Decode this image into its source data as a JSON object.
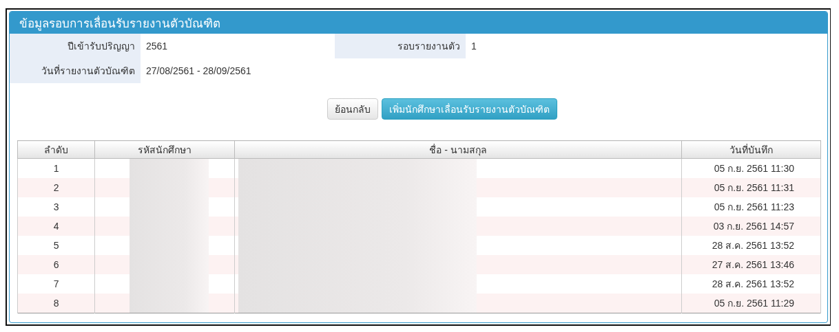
{
  "panel": {
    "title": "ข้อมูลรอบการเลื่อนรับรายงานตัวบัณฑิต"
  },
  "fields": [
    {
      "label": "ปีเข้ารับปริญญา",
      "value": "2561"
    },
    {
      "label": "รอบรายงานตัว",
      "value": "1"
    },
    {
      "label": "วันที่รายงานตัวบัณฑิต",
      "value": "27/08/2561 - 28/09/2561"
    }
  ],
  "buttons": [
    {
      "label": "ย้อนกลับ",
      "kind": "default"
    },
    {
      "label": "เพิ่มนักศึกษาเลื่อนรับรายงานตัวบัณฑิต",
      "kind": "primary"
    }
  ],
  "table": {
    "columns": [
      "ลำดับ",
      "รหัสนักศึกษา",
      "ชื่อ - นามสกุล",
      "วันที่บันทึก"
    ],
    "rows": [
      {
        "no": "1",
        "redacted": true,
        "date": "05 ก.ย. 2561 11:30"
      },
      {
        "no": "2",
        "redacted": true,
        "date": "05 ก.ย. 2561 11:31"
      },
      {
        "no": "3",
        "redacted": true,
        "date": "05 ก.ย. 2561 11:23"
      },
      {
        "no": "4",
        "redacted": true,
        "date": "03 ก.ย. 2561 14:57"
      },
      {
        "no": "5",
        "redacted": true,
        "date": "28 ส.ค. 2561 13:52"
      },
      {
        "no": "6",
        "redacted": true,
        "date": "27 ส.ค. 2561 13:46"
      },
      {
        "no": "7",
        "redacted": true,
        "date": "28 ส.ค. 2561 13:52"
      },
      {
        "no": "8",
        "redacted": true,
        "date": "05 ก.ย. 2561 11:29"
      }
    ]
  }
}
